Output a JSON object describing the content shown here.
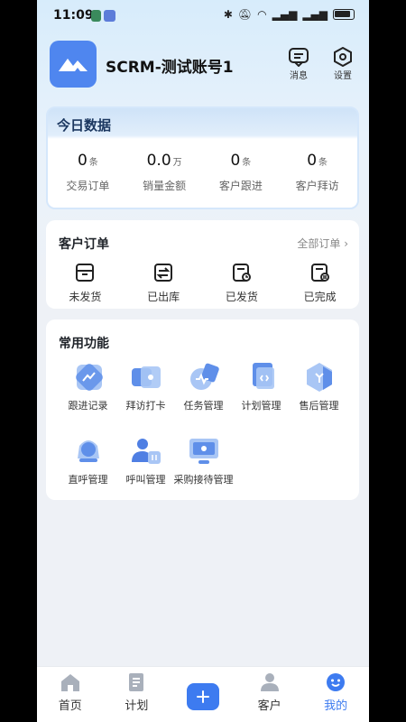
{
  "status_bar": {
    "time": "11:09"
  },
  "header": {
    "title": "SCRM-测试账号1",
    "messages_label": "消息",
    "settings_label": "设置"
  },
  "today": {
    "title": "今日数据",
    "stats": [
      {
        "value": "0",
        "unit": "条",
        "label": "交易订单"
      },
      {
        "value": "0.0",
        "unit": "万",
        "label": "销量金额"
      },
      {
        "value": "0",
        "unit": "条",
        "label": "客户跟进"
      },
      {
        "value": "0",
        "unit": "条",
        "label": "客户拜访"
      }
    ]
  },
  "orders": {
    "title": "客户订单",
    "all_label": "全部订单",
    "items": [
      {
        "label": "未发货",
        "icon": "unshipped-icon"
      },
      {
        "label": "已出库",
        "icon": "outbound-icon"
      },
      {
        "label": "已发货",
        "icon": "shipped-icon"
      },
      {
        "label": "已完成",
        "icon": "completed-icon"
      }
    ]
  },
  "functions": {
    "title": "常用功能",
    "items": [
      {
        "label": "跟进记录",
        "icon": "follow-record-icon"
      },
      {
        "label": "拜访打卡",
        "icon": "visit-checkin-icon"
      },
      {
        "label": "任务管理",
        "icon": "task-management-icon"
      },
      {
        "label": "计划管理",
        "icon": "plan-management-icon"
      },
      {
        "label": "售后管理",
        "icon": "after-sales-icon"
      },
      {
        "label": "直呼管理",
        "icon": "direct-call-icon"
      },
      {
        "label": "呼叫管理",
        "icon": "call-management-icon"
      },
      {
        "label": "采购接待管理",
        "icon": "purchase-reception-icon"
      }
    ]
  },
  "nav": {
    "items": [
      {
        "label": "首页",
        "icon": "home-icon"
      },
      {
        "label": "计划",
        "icon": "plan-icon"
      },
      {
        "label": "",
        "icon": "add-icon"
      },
      {
        "label": "客户",
        "icon": "customer-icon"
      },
      {
        "label": "我的",
        "icon": "profile-icon"
      }
    ],
    "active": "我的",
    "accent": "#3d7bf0"
  }
}
